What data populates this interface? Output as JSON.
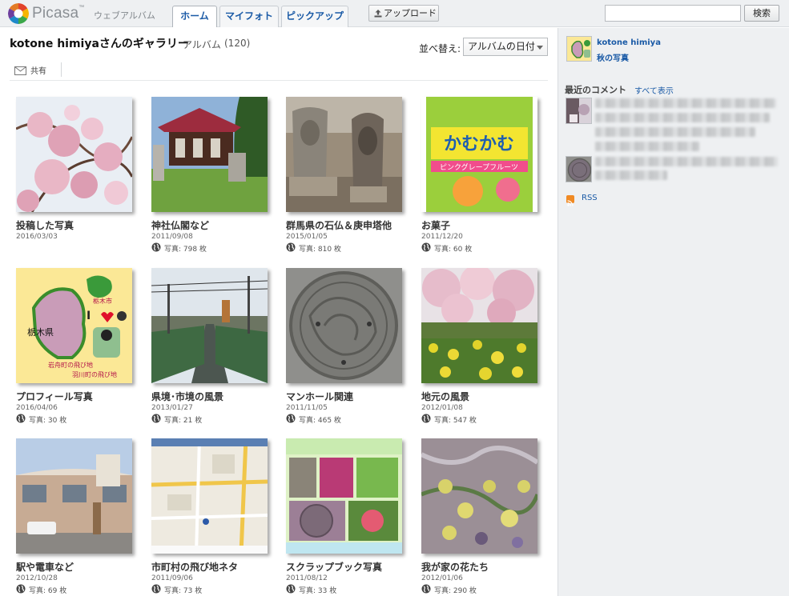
{
  "header": {
    "brand": "Picasa",
    "brand_tm": "™",
    "subtitle": "ウェブアルバム",
    "tabs": [
      "ホーム",
      "マイフォト",
      "ピックアップ"
    ],
    "upload_label": "アップロード",
    "search_placeholder": "",
    "search_button": "検索"
  },
  "gallery": {
    "title": "kotone himiyaさんのギャラリー",
    "album_label": "アルバム",
    "album_count": "(120)",
    "sort_label": "並べ替え:",
    "sort_value": "アルバムの日付",
    "share_label": "共有"
  },
  "albums": [
    {
      "title": "投稿した写真",
      "date": "2016/03/03",
      "photos": ""
    },
    {
      "title": "神社仏閣など",
      "date": "2011/09/08",
      "photos": "写真: 798 枚"
    },
    {
      "title": "群馬県の石仏＆庚申塔他",
      "date": "2015/01/05",
      "photos": "写真: 810 枚"
    },
    {
      "title": "お菓子",
      "date": "2011/12/20",
      "photos": "写真: 60 枚"
    },
    {
      "title": "プロフィール写真",
      "date": "2016/04/06",
      "photos": "写真: 30 枚"
    },
    {
      "title": "県境･市境の風景",
      "date": "2013/01/27",
      "photos": "写真: 21 枚"
    },
    {
      "title": "マンホール関連",
      "date": "2011/11/05",
      "photos": "写真: 465 枚"
    },
    {
      "title": "地元の風景",
      "date": "2012/01/08",
      "photos": "写真: 547 枚"
    },
    {
      "title": "駅や電車など",
      "date": "2012/10/28",
      "photos": "写真: 69 枚"
    },
    {
      "title": "市町村の飛び地ネタ",
      "date": "2011/09/06",
      "photos": "写真: 73 枚"
    },
    {
      "title": "スクラップブック写真",
      "date": "2011/08/12",
      "photos": "写真: 33 枚"
    },
    {
      "title": "我が家の花たち",
      "date": "2012/01/06",
      "photos": "写真: 290 枚"
    }
  ],
  "thumbnail_texts": {
    "candy_brand": "かむかむ",
    "candy_flavor": "ピンクグレープフルーツ",
    "profile_pref": "栃木県",
    "profile_love": "I",
    "profile_town1": "岩舟町の飛び地",
    "profile_town2": "羽川町の飛び地",
    "profile_city": "栃木市"
  },
  "sidebar": {
    "user_name": "kotone himiya",
    "featured_album": "秋の写真",
    "comments_heading": "最近のコメント",
    "show_all": "すべて表示",
    "rss_label": "RSS"
  },
  "colors": {
    "link": "#1a5aa6",
    "topbar_bg": "#eef0f2",
    "sidebar_bg": "#eef0f2"
  }
}
